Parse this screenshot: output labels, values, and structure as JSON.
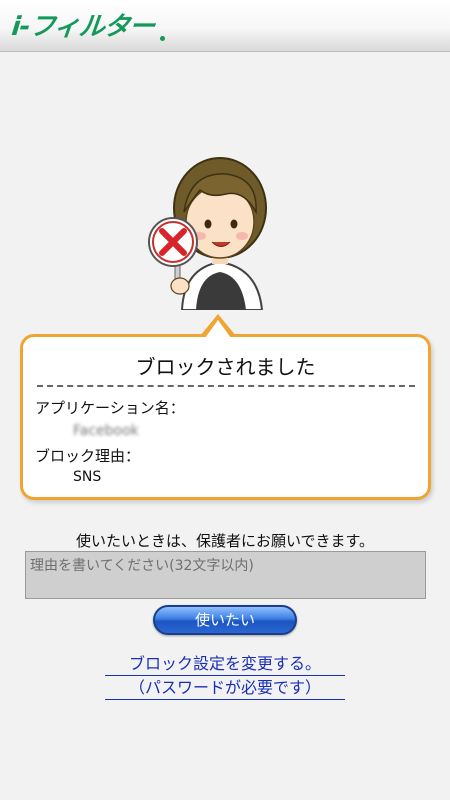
{
  "header": {
    "logo_text": "i-フィルター",
    "brand_color": "#14995a"
  },
  "character": {
    "icon": "girl-with-x-sign-icon"
  },
  "block_dialog": {
    "title": "ブロックされました",
    "app_name_label": "アプリケーション名：",
    "app_name_value": "Facebook",
    "reason_label": "ブロック理由：",
    "reason_value": "SNS",
    "border_color": "#f0a533"
  },
  "notice": "使いたいときは、保護者にお願いできます。",
  "reason_input": {
    "placeholder": "理由を書いてください(32文字以内)",
    "value": ""
  },
  "use_button_label": "使いたい",
  "change_settings_link": {
    "line1": "ブロック設定を変更する。",
    "line2": "（パスワードが必要です）"
  }
}
